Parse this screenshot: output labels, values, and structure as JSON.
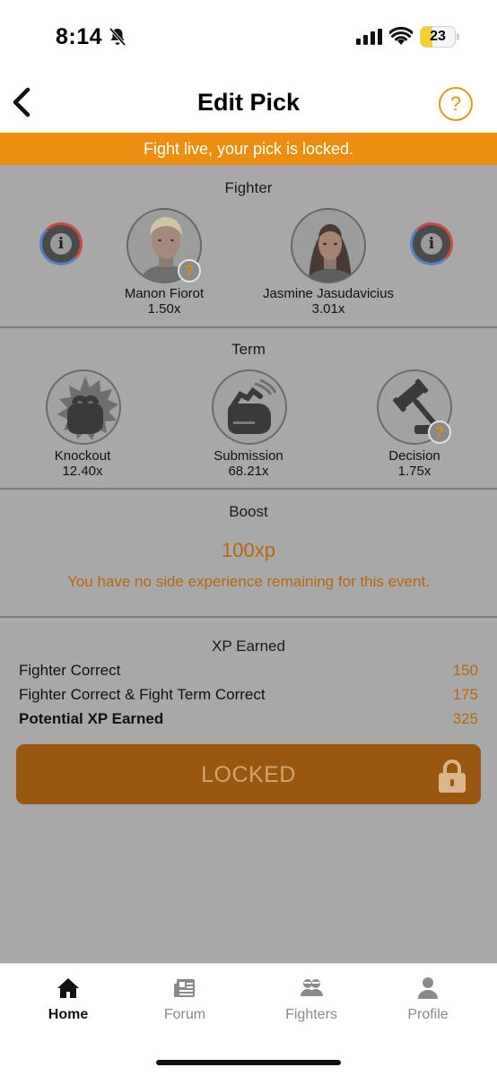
{
  "status_bar": {
    "time": "8:14",
    "battery": "23",
    "icons": [
      "bell-muted-icon",
      "signal-icon",
      "wifi-icon",
      "battery-icon"
    ]
  },
  "header": {
    "title": "Edit Pick",
    "back_icon": "chevron-left-icon",
    "help_label": "?"
  },
  "banner": {
    "text": "Fight live, your pick is locked."
  },
  "fighter_section": {
    "title": "Fighter",
    "fighters": [
      {
        "name": "Manon Fiorot",
        "odds": "1.50x"
      },
      {
        "name": "Jasmine Jasudavicius",
        "odds": "3.01x"
      }
    ],
    "info_label": "i",
    "badge_label": "?"
  },
  "term_section": {
    "title": "Term",
    "terms": [
      {
        "name": "Knockout",
        "odds": "12.40x",
        "icon": "fist-icon"
      },
      {
        "name": "Submission",
        "odds": "68.21x",
        "icon": "glove-grab-icon"
      },
      {
        "name": "Decision",
        "odds": "1.75x",
        "icon": "gavel-icon"
      }
    ],
    "badge_label": "?"
  },
  "boost_section": {
    "title": "Boost",
    "value": "100xp",
    "note": "You have no side experience remaining for this event."
  },
  "xp_section": {
    "title": "XP Earned",
    "rows": [
      {
        "label": "Fighter Correct",
        "value": "150"
      },
      {
        "label": "Fighter Correct & Fight Term Correct",
        "value": "175"
      },
      {
        "label": "Potential XP Earned",
        "value": "325"
      }
    ]
  },
  "locked_button": {
    "label": "LOCKED",
    "icon": "lock-icon"
  },
  "colors": {
    "accent": "#ec8e10",
    "accent_text": "#b6670e",
    "locked_button": "#99570f",
    "overlay": "#a8a8a8"
  },
  "tabs": [
    {
      "label": "Home",
      "icon": "home-icon",
      "active": true
    },
    {
      "label": "Forum",
      "icon": "newspaper-icon",
      "active": false
    },
    {
      "label": "Fighters",
      "icon": "fighters-icon",
      "active": false
    },
    {
      "label": "Profile",
      "icon": "person-icon",
      "active": false
    }
  ]
}
